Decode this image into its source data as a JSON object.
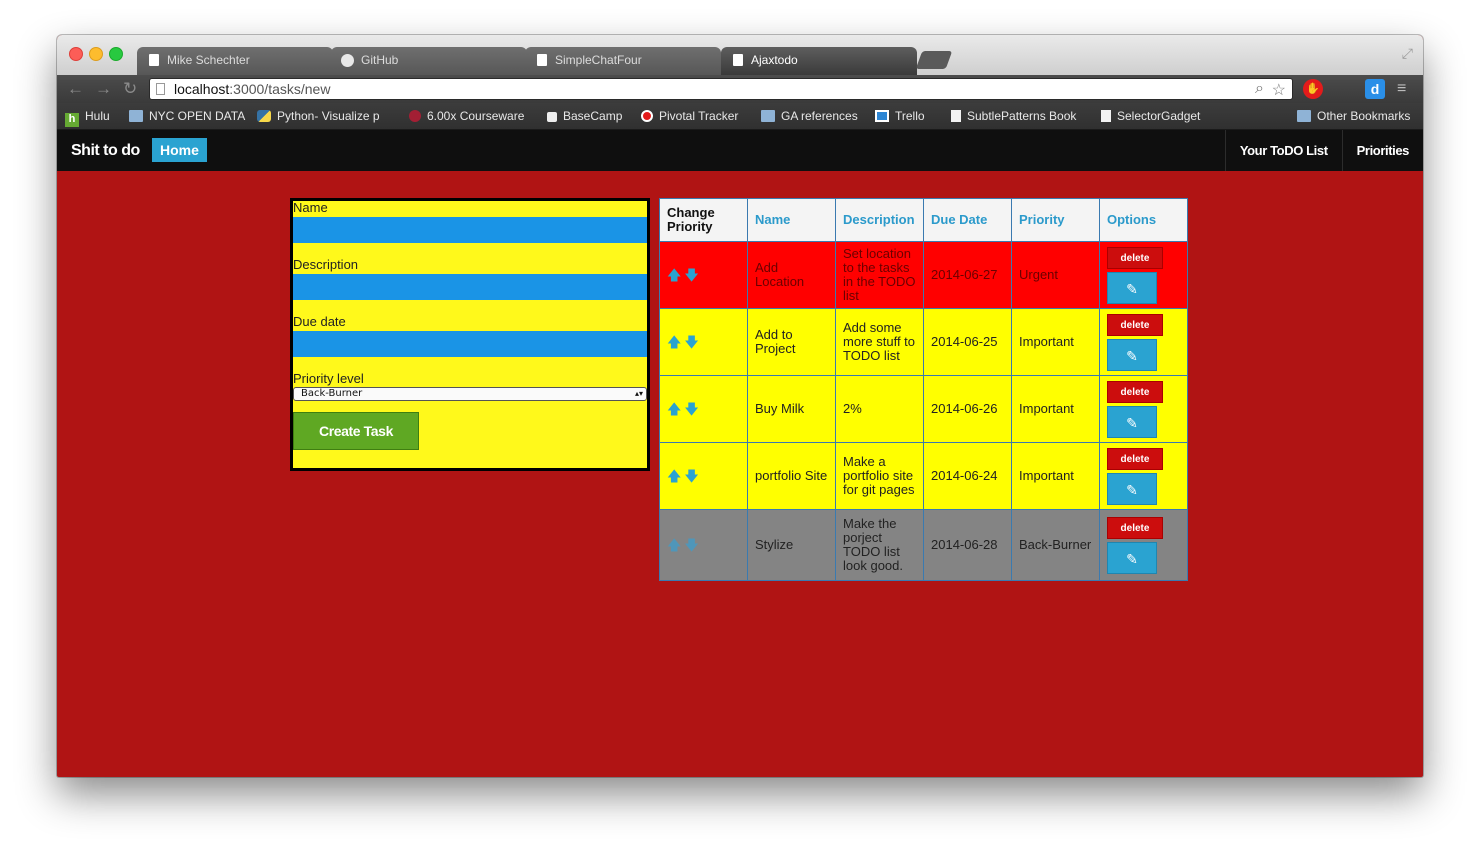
{
  "browser": {
    "tabs": [
      {
        "label": "Mike Schechter",
        "icon": "document-icon"
      },
      {
        "label": "GitHub",
        "icon": "github-icon"
      },
      {
        "label": "SimpleChatFour",
        "icon": "document-icon"
      },
      {
        "label": "Ajaxtodo",
        "icon": "document-icon",
        "active": true
      }
    ],
    "url_host": "localhost",
    "url_rest": ":3000/tasks/new",
    "bookmarks": [
      {
        "label": "Hulu",
        "icon": "hulu-icon"
      },
      {
        "label": "NYC OPEN DATA",
        "icon": "folder-icon"
      },
      {
        "label": "Python- Visualize p",
        "icon": "python-icon"
      },
      {
        "label": "6.00x Courseware",
        "icon": "edx-icon"
      },
      {
        "label": "BaseCamp",
        "icon": "basecamp-icon"
      },
      {
        "label": "Pivotal Tracker",
        "icon": "pivotal-icon"
      },
      {
        "label": "GA references",
        "icon": "folder-icon"
      },
      {
        "label": "Trello",
        "icon": "trello-icon"
      },
      {
        "label": "SubtlePatterns Book",
        "icon": "document-icon"
      },
      {
        "label": "SelectorGadget",
        "icon": "document-icon"
      }
    ],
    "other_bookmarks": "Other Bookmarks"
  },
  "app": {
    "brand": "Shit to do",
    "home": "Home",
    "nav_right": [
      "Your ToDO List",
      "Priorities"
    ]
  },
  "form": {
    "name_label": "Name",
    "description_label": "Description",
    "due_label": "Due date",
    "priority_label": "Priority level",
    "priority_selected": "Back-Burner",
    "submit": "Create Task"
  },
  "table": {
    "headers": [
      "Change Priority",
      "Name",
      "Description",
      "Due Date",
      "Priority",
      "Options"
    ],
    "delete_label": "delete",
    "rows": [
      {
        "name": "Add Location",
        "description": "Set location to the tasks in the TODO list",
        "due": "2014-06-27",
        "priority": "Urgent",
        "color": "#ff0000"
      },
      {
        "name": "Add to Project",
        "description": "Add some more stuff to TODO list",
        "due": "2014-06-25",
        "priority": "Important",
        "color": "#ffff00"
      },
      {
        "name": "Buy Milk",
        "description": "2%",
        "due": "2014-06-26",
        "priority": "Important",
        "color": "#ffff00"
      },
      {
        "name": "portfolio Site",
        "description": "Make a portfolio site for git pages",
        "due": "2014-06-24",
        "priority": "Important",
        "color": "#ffff00"
      },
      {
        "name": "Stylize",
        "description": "Make the porject TODO list look good.",
        "due": "2014-06-28",
        "priority": "Back-Burner",
        "color": "#848484"
      }
    ]
  },
  "colors": {
    "page_background": "#b01414",
    "form_background": "#fff91b",
    "input_fill": "#1a94e6",
    "accent": "#2aa3d1",
    "create_button": "#5fa823",
    "delete_button": "#cc0d0d"
  }
}
